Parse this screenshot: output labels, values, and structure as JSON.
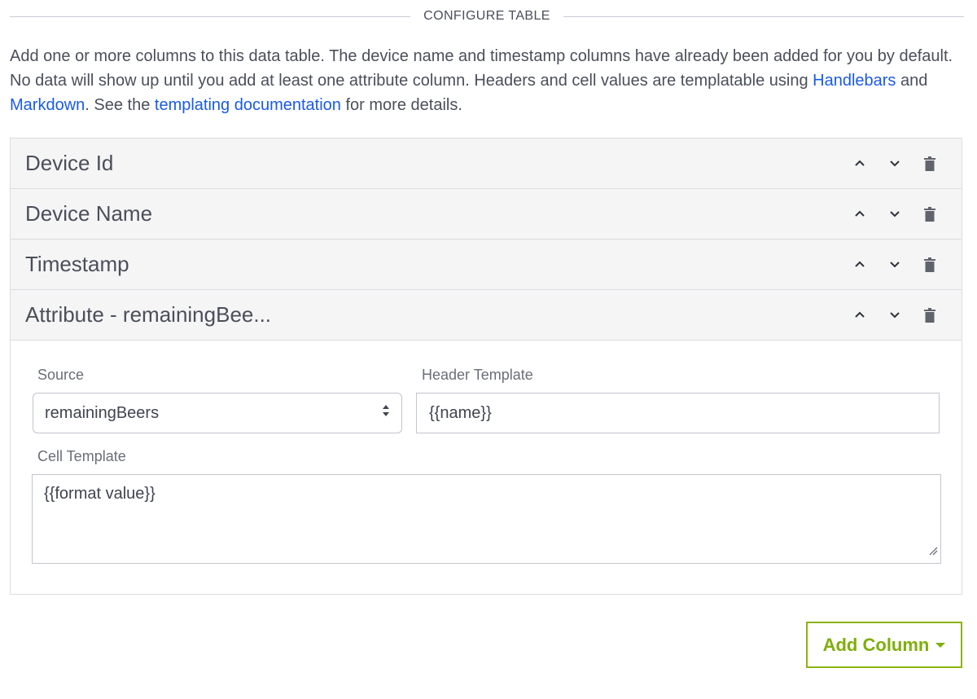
{
  "section": {
    "title": "CONFIGURE TABLE"
  },
  "intro": {
    "part1": "Add one or more columns to this data table. The device name and timestamp columns have already been added for you by default. No data will show up until you add at least one attribute column. Headers and cell values are templatable using ",
    "link_handlebars": "Handlebars",
    "part2": " and ",
    "link_markdown": "Markdown",
    "part3": ". See the ",
    "link_docs": "templating documentation",
    "part4": " for more details."
  },
  "columns": [
    {
      "name": "Device Id"
    },
    {
      "name": "Device Name"
    },
    {
      "name": "Timestamp"
    },
    {
      "name": "Attribute - remainingBee..."
    }
  ],
  "editor": {
    "source_label": "Source",
    "source_value": "remainingBeers",
    "header_label": "Header Template",
    "header_value": "{{name}}",
    "cell_label": "Cell Template",
    "cell_value": "{{format value}}"
  },
  "add_button": {
    "label": "Add Column"
  },
  "icons": {
    "up": "chevron-up-icon",
    "down": "chevron-down-icon",
    "delete": "trash-icon",
    "select": "select-arrows-icon",
    "resize": "resize-grip-icon",
    "caret": "caret-down-icon"
  },
  "colors": {
    "link": "#1a5ae8",
    "accent": "#8cb40f",
    "row_bg": "#f5f5f6",
    "border": "#dcdde1"
  }
}
